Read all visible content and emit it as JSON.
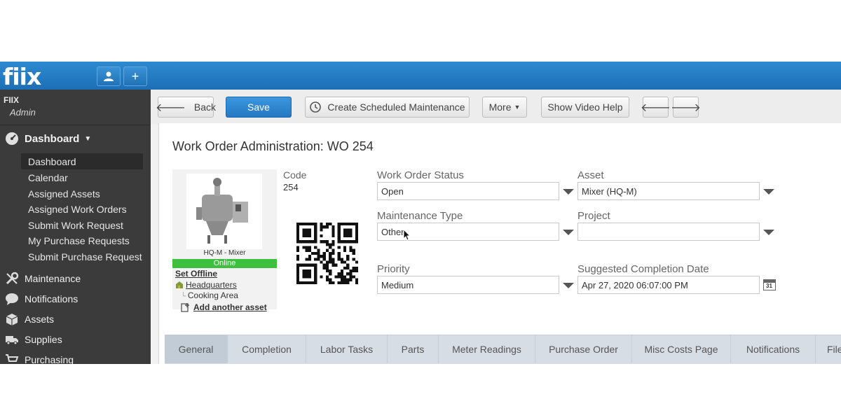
{
  "app": {
    "logo": "fiix",
    "brand_color": "#1c6fb5"
  },
  "topbar": {
    "user_icon": "user-icon",
    "add_label": "+"
  },
  "sidebar": {
    "org_name": "FIIX",
    "role": "Admin",
    "dashboard": {
      "label": "Dashboard",
      "items": [
        "Dashboard",
        "Calendar",
        "Assigned Assets",
        "Assigned Work Orders",
        "Submit Work Request",
        "My Purchase Requests",
        "Submit Purchase Request"
      ],
      "active_index": 0
    },
    "sections": [
      "Maintenance",
      "Notifications",
      "Assets",
      "Supplies",
      "Purchasing"
    ]
  },
  "toolbar": {
    "back": "Back",
    "save": "Save",
    "create_scheduled": "Create Scheduled Maintenance",
    "more": "More",
    "video_help": "Show Video Help"
  },
  "work_order": {
    "title": "Work Order Administration: WO 254",
    "code_label": "Code",
    "code_value": "254",
    "asset_card": {
      "name": "HQ-M - Mixer",
      "status": "Online",
      "set_offline": "Set Offline",
      "location": "Headquarters",
      "sub_location": "Cooking Area",
      "add_another": "Add another asset"
    },
    "fields": {
      "status_label": "Work Order Status",
      "status_value": "Open",
      "asset_label": "Asset",
      "asset_value": "Mixer (HQ-M)",
      "maintenance_type_label": "Maintenance Type",
      "maintenance_type_value": "Other",
      "project_label": "Project",
      "project_value": "",
      "priority_label": "Priority",
      "priority_value": "Medium",
      "completion_label": "Suggested Completion Date",
      "completion_value": "Apr 27, 2020 06:07:00 PM",
      "calendar_day": "31"
    }
  },
  "tabs": {
    "items": [
      "General",
      "Completion",
      "Labor Tasks",
      "Parts",
      "Meter Readings",
      "Purchase Order",
      "Misc Costs Page",
      "Notifications",
      "File"
    ],
    "active_index": 0
  }
}
